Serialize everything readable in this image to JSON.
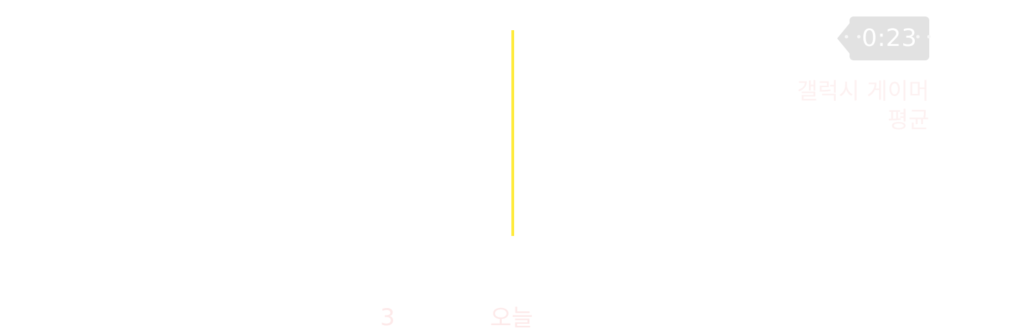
{
  "tooltip": {
    "value": "0:23"
  },
  "legend": {
    "label": "갤럭시 게이머\n평균"
  },
  "axis": {
    "ticks": [
      "3",
      "오늘"
    ]
  },
  "colors": {
    "today_bar": "#ffeb3b",
    "tooltip_bg": "#e2e2e2",
    "label_text": "#fde9e9"
  }
}
